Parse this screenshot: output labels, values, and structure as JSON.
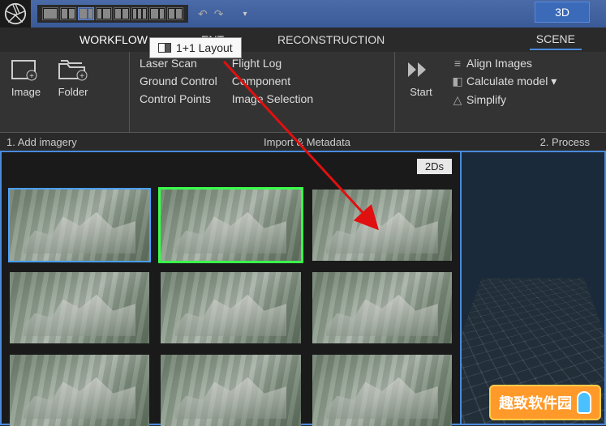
{
  "titlebar": {
    "btn3d": "3D"
  },
  "tooltip": {
    "text": "1+1 Layout"
  },
  "tabs": {
    "workflow": "WORKFLOW",
    "ent": "ENT",
    "reconstruction": "RECONSTRUCTION",
    "scene": "SCENE"
  },
  "ribbon": {
    "image": "Image",
    "folder": "Folder",
    "laser_scan": "Laser Scan",
    "ground_control": "Ground Control",
    "control_points": "Control Points",
    "flight_log": "Flight Log",
    "component": "Component",
    "image_selection": "Image Selection",
    "start": "Start",
    "align_images": "Align Images",
    "calculate_model": "Calculate model ▾",
    "simplify": "Simplify"
  },
  "sections": {
    "s1": "1. Add imagery",
    "s2": "Import & Metadata",
    "s3": "2. Process"
  },
  "gallery": {
    "badge": "2Ds"
  },
  "watermark": {
    "text": "趣致软件园"
  }
}
